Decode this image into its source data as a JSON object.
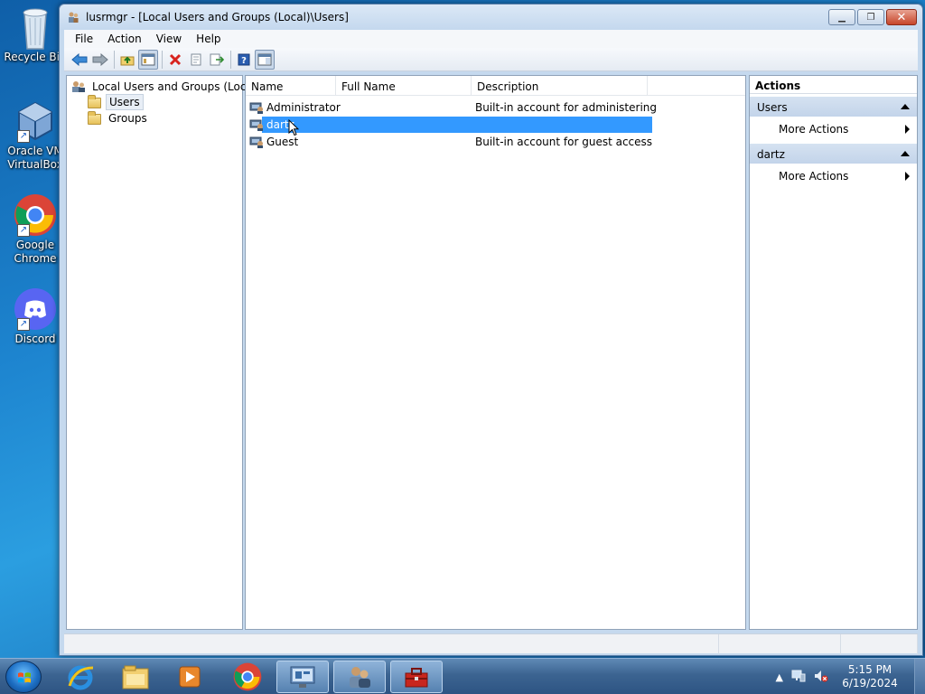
{
  "desktop": {
    "icons": [
      {
        "label": "Recycle Bin",
        "icon": "recycle-bin-icon"
      },
      {
        "label": "Oracle VM\nVirtualBox",
        "icon": "virtualbox-icon"
      },
      {
        "label": "Google\nChrome",
        "icon": "chrome-icon"
      },
      {
        "label": "Discord",
        "icon": "discord-icon"
      }
    ]
  },
  "window": {
    "title": "lusrmgr - [Local Users and Groups (Local)\\Users]",
    "controls": {
      "minimize": "minimize-icon",
      "maximize": "maximize-icon",
      "close": "close-icon"
    }
  },
  "menu": {
    "file": "File",
    "action": "Action",
    "view": "View",
    "help": "Help"
  },
  "toolbar": {
    "buttons": [
      "back-icon",
      "forward-icon",
      "up-folder-icon",
      "show-hide-tree-icon",
      "delete-icon",
      "properties-icon",
      "export-icon",
      "help-icon",
      "show-hide-action-pane-icon"
    ]
  },
  "tree": {
    "root": "Local Users and Groups (Local)",
    "children": [
      "Users",
      "Groups"
    ],
    "selected": "Users"
  },
  "list": {
    "columns": [
      "Name",
      "Full Name",
      "Description"
    ],
    "rows": [
      {
        "name": "Administrator",
        "full_name": "",
        "description": "Built-in account for administering..."
      },
      {
        "name": "dartz",
        "full_name": "",
        "description": ""
      },
      {
        "name": "Guest",
        "full_name": "",
        "description": "Built-in account for guest access t..."
      }
    ],
    "selected_row": "dartz"
  },
  "actions": {
    "title": "Actions",
    "sections": [
      {
        "header": "Users",
        "items": [
          "More Actions"
        ]
      },
      {
        "header": "dartz",
        "items": [
          "More Actions"
        ]
      }
    ]
  },
  "taskbar": {
    "apps": [
      "internet-explorer-icon",
      "file-explorer-icon",
      "media-player-icon",
      "chrome-icon",
      "computer-management-icon",
      "users-icon",
      "toolbox-icon"
    ],
    "clock_time": "5:15 PM",
    "clock_date": "6/19/2024"
  },
  "colors": {
    "selection": "#3399ff",
    "titlebar": "#c4d8ee",
    "desktop": "#1d84cf"
  }
}
